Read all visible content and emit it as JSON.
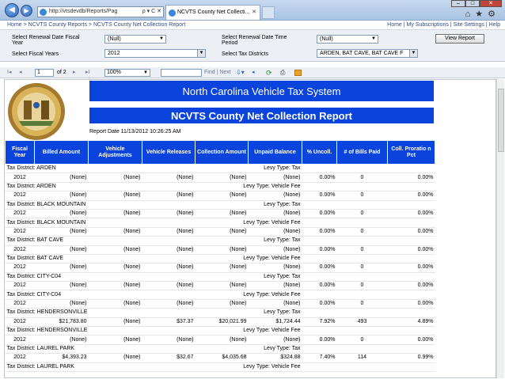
{
  "browser": {
    "url": "http://vtsdevdb/Reports/Pag",
    "address_suffix": "ρ ▾ C ✕",
    "tab_title": "NCVTS County Net Collecti...",
    "tab_close": "✕"
  },
  "breadcrumb": {
    "items": [
      "Home",
      "NCVTS County Reports",
      "NCVTS County Net Collection Report"
    ],
    "separator": " > ",
    "links": [
      "Home",
      "My Subscriptions",
      "Site Settings",
      "Help"
    ]
  },
  "params": {
    "renewal_year_label": "Select Renewal Date Fiscal Year",
    "renewal_year_value": "(Null)",
    "renewal_period_label": "Select Renewal Date Time Period",
    "renewal_period_value": "(Null)",
    "fiscal_years_label": "Select Fiscal Years",
    "fiscal_years_value": "2012",
    "tax_districts_label": "Select Tax Districts",
    "tax_districts_value": "ARDEN, BAT CAVE, BAT CAVE F",
    "view_report": "View Report"
  },
  "toolbar": {
    "first": "I◂",
    "prev": "◂",
    "page": "1",
    "of_pages": "of 2",
    "next": "▸",
    "last": "▸I",
    "zoom": "100%",
    "find_label": "Find | Next",
    "back_icon": "◂"
  },
  "report": {
    "title": "North Carolina Vehicle Tax System",
    "subtitle": "NCVTS County Net Collection Report",
    "report_date": "Report Date 11/13/2012 10:26:25 AM",
    "columns": [
      "Fiscal Year",
      "Billed Amount",
      "Vehicle Adjustments",
      "Vehicle Releases",
      "Collection Amount",
      "Unpaid Balance",
      "% Uncoll.",
      "# of Bills Paid",
      "Coll. Proratio n Pct"
    ],
    "rows": [
      {
        "district": "Tax District: ARDEN",
        "levy": "Levy Type: Tax",
        "year": "2012",
        "billed": "(None)",
        "adj": "(None)",
        "rel": "(None)",
        "coll": "(None)",
        "unpaid": "(None)",
        "pct": "0.00%",
        "bills": "0",
        "pror": "0.00%"
      },
      {
        "district": "Tax District: ARDEN",
        "levy": "Levy Type: Vehicle Fee",
        "year": "2012",
        "billed": "(None)",
        "adj": "(None)",
        "rel": "(None)",
        "coll": "(None)",
        "unpaid": "(None)",
        "pct": "0.00%",
        "bills": "0",
        "pror": "0.00%"
      },
      {
        "district": "Tax District: BLACK MOUNTAIN",
        "levy": "Levy Type: Tax",
        "year": "2012",
        "billed": "(None)",
        "adj": "(None)",
        "rel": "(None)",
        "coll": "(None)",
        "unpaid": "(None)",
        "pct": "0.00%",
        "bills": "0",
        "pror": "0.00%"
      },
      {
        "district": "Tax District: BLACK MOUNTAIN",
        "levy": "Levy Type: Vehicle Fee",
        "year": "2012",
        "billed": "(None)",
        "adj": "(None)",
        "rel": "(None)",
        "coll": "(None)",
        "unpaid": "(None)",
        "pct": "0.00%",
        "bills": "0",
        "pror": "0.00%"
      },
      {
        "district": "Tax District: BAT CAVE",
        "levy": "Levy Type: Tax",
        "year": "2012",
        "billed": "(None)",
        "adj": "(None)",
        "rel": "(None)",
        "coll": "(None)",
        "unpaid": "(None)",
        "pct": "0.00%",
        "bills": "0",
        "pror": "0.00%"
      },
      {
        "district": "Tax District: BAT CAVE",
        "levy": "Levy Type: Vehicle Fee",
        "year": "2012",
        "billed": "(None)",
        "adj": "(None)",
        "rel": "(None)",
        "coll": "(None)",
        "unpaid": "(None)",
        "pct": "0.00%",
        "bills": "0",
        "pror": "0.00%"
      },
      {
        "district": "Tax District: CITY-C04",
        "levy": "Levy Type: Tax",
        "year": "2012",
        "billed": "(None)",
        "adj": "(None)",
        "rel": "(None)",
        "coll": "(None)",
        "unpaid": "(None)",
        "pct": "0.00%",
        "bills": "0",
        "pror": "0.00%"
      },
      {
        "district": "Tax District: CITY-C04",
        "levy": "Levy Type: Vehicle Fee",
        "year": "2012",
        "billed": "(None)",
        "adj": "(None)",
        "rel": "(None)",
        "coll": "(None)",
        "unpaid": "(None)",
        "pct": "0.00%",
        "bills": "0",
        "pror": "0.00%"
      },
      {
        "district": "Tax District: HENDERSONVILLE",
        "levy": "Levy Type: Tax",
        "year": "2012",
        "billed": "$21,783.80",
        "adj": "(None)",
        "rel": "$37.37",
        "coll": "$20,021.99",
        "unpaid": "$1,724.44",
        "pct": "7.92%",
        "bills": "493",
        "pror": "4.89%"
      },
      {
        "district": "Tax District: HENDERSONVILLE",
        "levy": "Levy Type: Vehicle Fee",
        "year": "2012",
        "billed": "(None)",
        "adj": "(None)",
        "rel": "(None)",
        "coll": "(None)",
        "unpaid": "(None)",
        "pct": "0.00%",
        "bills": "0",
        "pror": "0.00%"
      },
      {
        "district": "Tax District: LAUREL PARK",
        "levy": "Levy Type: Tax",
        "year": "2012",
        "billed": "$4,393.23",
        "adj": "(None)",
        "rel": "$32.67",
        "coll": "$4,035.68",
        "unpaid": "$324.88",
        "pct": "7.40%",
        "bills": "114",
        "pror": "0.99%"
      },
      {
        "district": "Tax District: LAUREL PARK",
        "levy": "Levy Type: Vehicle Fee",
        "year": "",
        "billed": "",
        "adj": "",
        "rel": "",
        "coll": "",
        "unpaid": "",
        "pct": "",
        "bills": "",
        "pror": ""
      }
    ]
  },
  "colors": {
    "banner": "#0b43dd",
    "link": "#334c80"
  }
}
